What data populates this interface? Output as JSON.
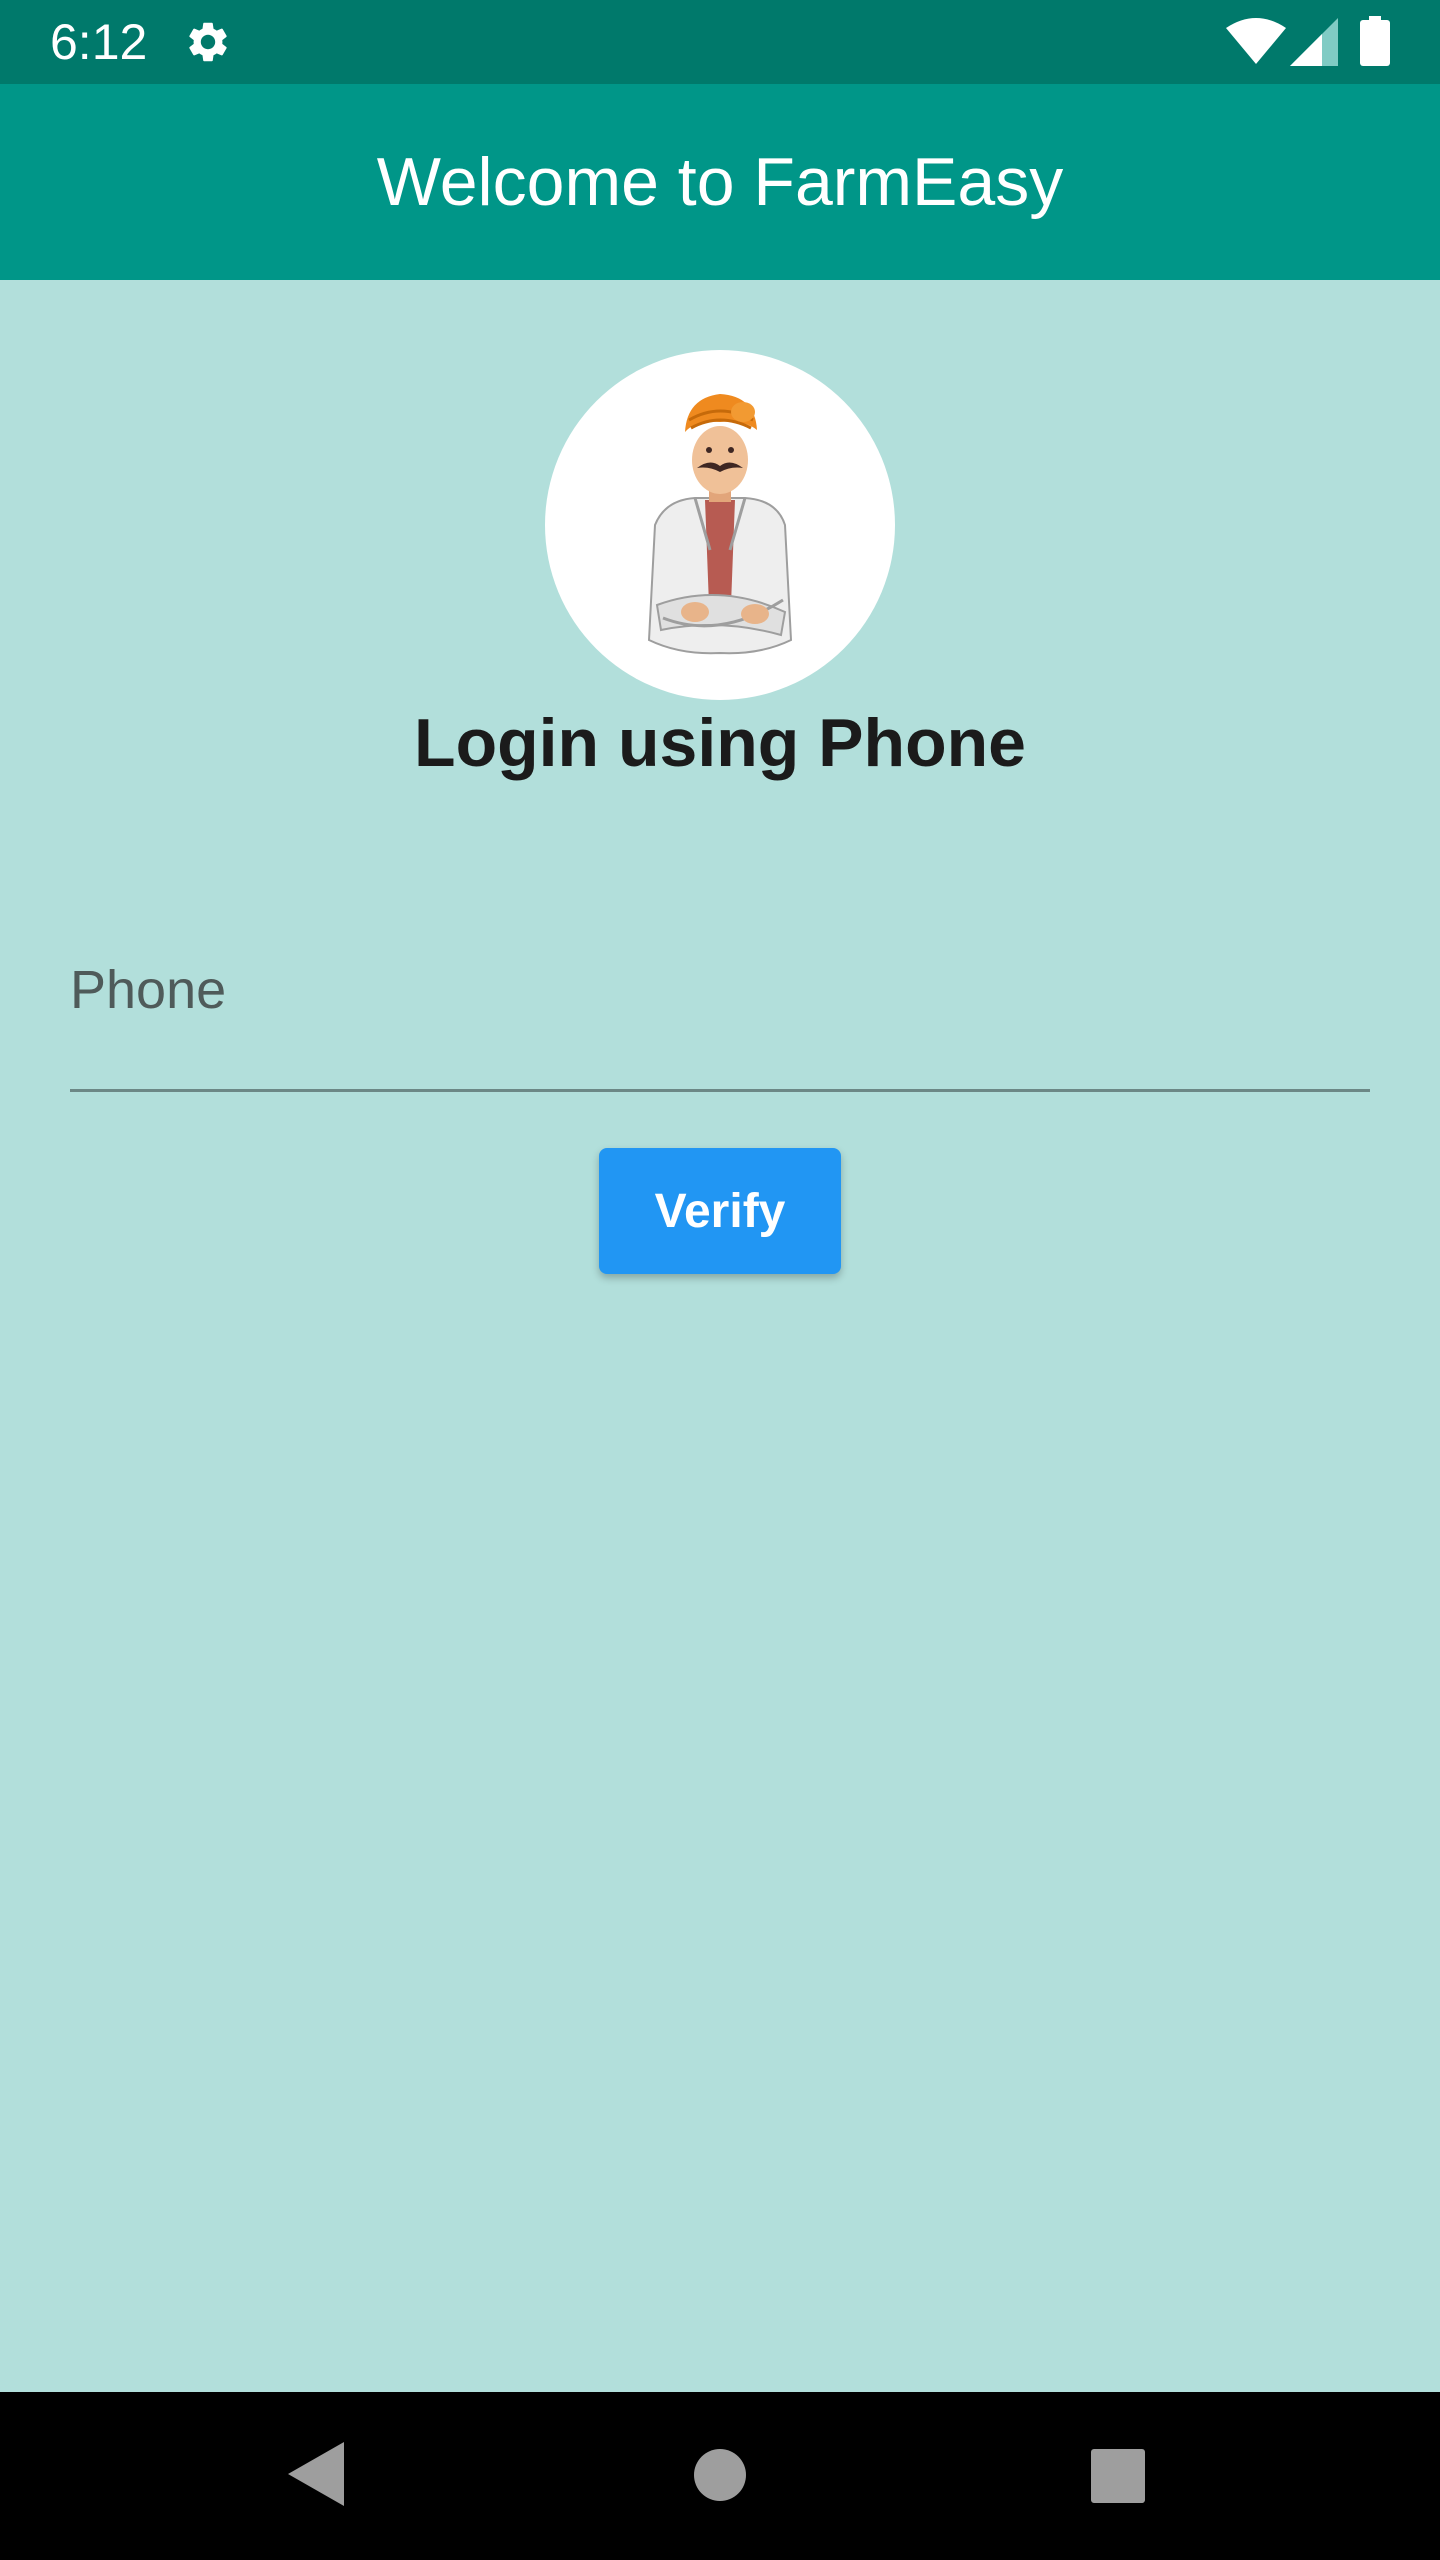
{
  "status_bar": {
    "time": "6:12",
    "icons": [
      "gear-icon",
      "wifi-icon",
      "signal-icon",
      "battery-icon"
    ]
  },
  "app_bar": {
    "title": "Welcome to FarmEasy",
    "color": "#009688"
  },
  "login": {
    "avatar_icon": "farmer-avatar-icon",
    "heading": "Login using Phone",
    "phone_placeholder": "Phone",
    "phone_value": "",
    "verify_label": "Verify"
  },
  "nav_bar": {
    "icons": [
      "back-icon",
      "home-icon",
      "recents-icon"
    ]
  },
  "colors": {
    "status_bar": "#00796b",
    "background": "#b2dfdb",
    "accent_button": "#2196f3"
  }
}
